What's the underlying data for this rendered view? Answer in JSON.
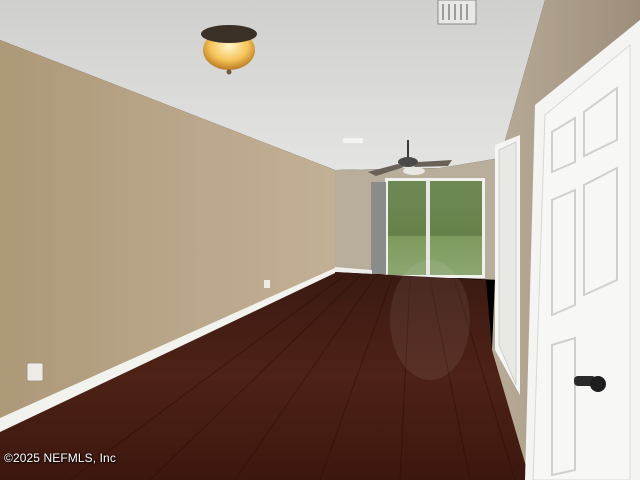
{
  "photo": {
    "subject": "empty-room-interior",
    "colors": {
      "ceiling": "#d8d8d6",
      "left_wall": "#b8a488",
      "right_wall": "#a89a86",
      "floor": "#4a1f14",
      "baseboard": "#f2f2ee",
      "door": "#f4f4f2",
      "lawn": "#7a9a5a"
    },
    "icons": [
      "ceiling-light-icon",
      "ceiling-fan-icon",
      "air-vent-icon",
      "door-knob-icon",
      "outlet-icon"
    ]
  },
  "watermark": {
    "text": "©2025 NEFMLS, Inc"
  }
}
